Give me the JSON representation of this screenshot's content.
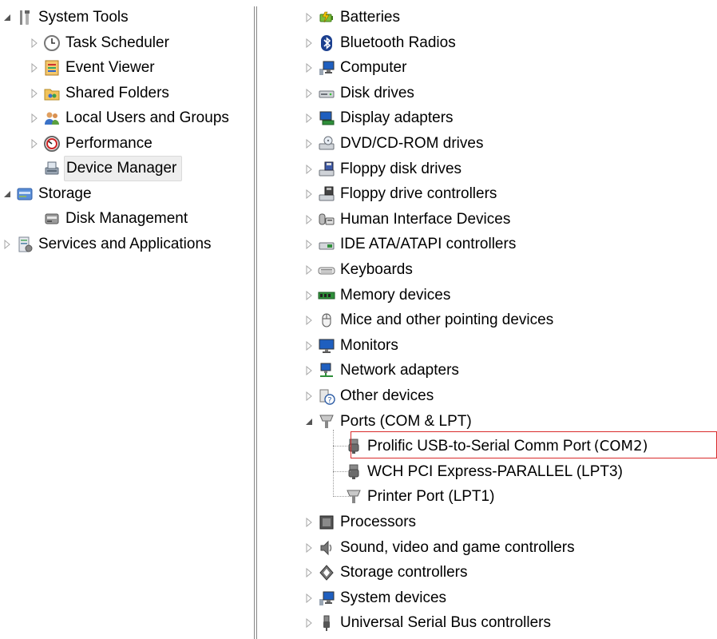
{
  "left_tree": [
    {
      "key": "system_tools",
      "label": "System Tools",
      "icon": "tools-icon",
      "indent": 0,
      "toggle": "expanded"
    },
    {
      "key": "task_scheduler",
      "label": "Task Scheduler",
      "icon": "clock-icon",
      "indent": 1,
      "toggle": "collapsed"
    },
    {
      "key": "event_viewer",
      "label": "Event Viewer",
      "icon": "event-log-icon",
      "indent": 1,
      "toggle": "collapsed"
    },
    {
      "key": "shared_folders",
      "label": "Shared Folders",
      "icon": "shared-folder-icon",
      "indent": 1,
      "toggle": "collapsed"
    },
    {
      "key": "local_users",
      "label": "Local Users and Groups",
      "icon": "users-icon",
      "indent": 1,
      "toggle": "collapsed"
    },
    {
      "key": "performance",
      "label": "Performance",
      "icon": "performance-icon",
      "indent": 1,
      "toggle": "collapsed"
    },
    {
      "key": "device_manager",
      "label": "Device Manager",
      "icon": "device-manager-icon",
      "indent": 1,
      "toggle": "none",
      "selected": true
    },
    {
      "key": "storage",
      "label": "Storage",
      "icon": "storage-icon",
      "indent": 0,
      "toggle": "expanded"
    },
    {
      "key": "disk_management",
      "label": "Disk Management",
      "icon": "disk-management-icon",
      "indent": 1,
      "toggle": "none"
    },
    {
      "key": "services_apps",
      "label": "Services and Applications",
      "icon": "services-icon",
      "indent": 0,
      "toggle": "collapsed"
    }
  ],
  "device_tree": [
    {
      "key": "batteries",
      "label": "Batteries",
      "icon": "battery-icon",
      "toggle": "collapsed"
    },
    {
      "key": "bluetooth",
      "label": "Bluetooth Radios",
      "icon": "bluetooth-icon",
      "toggle": "collapsed"
    },
    {
      "key": "computer",
      "label": "Computer",
      "icon": "computer-icon",
      "toggle": "collapsed"
    },
    {
      "key": "disk_drives",
      "label": "Disk drives",
      "icon": "disk-drive-icon",
      "toggle": "collapsed"
    },
    {
      "key": "display_adapters",
      "label": "Display adapters",
      "icon": "display-adapter-icon",
      "toggle": "collapsed"
    },
    {
      "key": "dvd",
      "label": "DVD/CD-ROM drives",
      "icon": "dvd-drive-icon",
      "toggle": "collapsed"
    },
    {
      "key": "floppy_drives",
      "label": "Floppy disk drives",
      "icon": "floppy-drive-icon",
      "toggle": "collapsed"
    },
    {
      "key": "floppy_ctrl",
      "label": "Floppy drive controllers",
      "icon": "floppy-controller-icon",
      "toggle": "collapsed"
    },
    {
      "key": "hid",
      "label": "Human Interface Devices",
      "icon": "hid-icon",
      "toggle": "collapsed"
    },
    {
      "key": "ide",
      "label": "IDE ATA/ATAPI controllers",
      "icon": "ide-controller-icon",
      "toggle": "collapsed"
    },
    {
      "key": "keyboards",
      "label": "Keyboards",
      "icon": "keyboard-icon",
      "toggle": "collapsed"
    },
    {
      "key": "memory",
      "label": "Memory devices",
      "icon": "memory-icon",
      "toggle": "collapsed"
    },
    {
      "key": "mice",
      "label": "Mice and other pointing devices",
      "icon": "mouse-icon",
      "toggle": "collapsed"
    },
    {
      "key": "monitors",
      "label": "Monitors",
      "icon": "monitor-icon",
      "toggle": "collapsed"
    },
    {
      "key": "network",
      "label": "Network adapters",
      "icon": "network-adapter-icon",
      "toggle": "collapsed"
    },
    {
      "key": "other",
      "label": "Other devices",
      "icon": "unknown-device-icon",
      "toggle": "collapsed"
    },
    {
      "key": "ports",
      "label": "Ports (COM & LPT)",
      "icon": "port-icon",
      "toggle": "expanded"
    },
    {
      "key": "prolific",
      "label": "Prolific USB-to-Serial Comm Port",
      "suffix": "(COM2)",
      "icon": "serial-port-icon",
      "toggle": "child",
      "highlighted": true
    },
    {
      "key": "wch",
      "label": "WCH PCI Express-PARALLEL (LPT3)",
      "icon": "serial-port-icon",
      "toggle": "child"
    },
    {
      "key": "printer_port",
      "label": "Printer Port (LPT1)",
      "icon": "port-icon",
      "toggle": "child"
    },
    {
      "key": "processors",
      "label": "Processors",
      "icon": "processor-icon",
      "toggle": "collapsed"
    },
    {
      "key": "sound",
      "label": "Sound, video and game controllers",
      "icon": "speaker-icon",
      "toggle": "collapsed"
    },
    {
      "key": "storage_ctrl",
      "label": "Storage controllers",
      "icon": "storage-controller-icon",
      "toggle": "collapsed"
    },
    {
      "key": "system_devices",
      "label": "System devices",
      "icon": "system-device-icon",
      "toggle": "collapsed"
    },
    {
      "key": "usb",
      "label": "Universal Serial Bus controllers",
      "icon": "usb-icon",
      "toggle": "collapsed"
    }
  ],
  "colors": {
    "highlight_border": "#d92b2b",
    "selection_bg": "#eeeeee",
    "expander": "#a6a6a6"
  }
}
